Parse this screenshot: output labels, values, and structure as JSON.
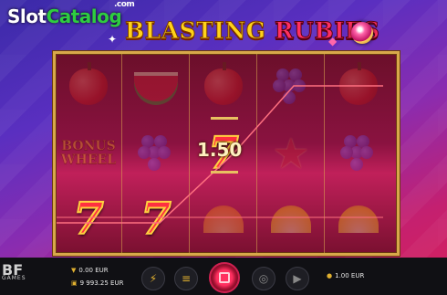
{
  "watermark": {
    "part1": "Slot",
    "part2": "Catalog",
    "suffix": ".com"
  },
  "game": {
    "title_part1": "BLASTING",
    "title_part2": "RUBIES"
  },
  "win": {
    "amount": "1.50"
  },
  "bonus_symbol": {
    "line1": "BONUS",
    "line2": "WHEEL"
  },
  "provider": {
    "logo": "BF",
    "sub": "GAMES"
  },
  "balance": {
    "win_value": "0.00 EUR",
    "balance_value": "9 993.25 EUR",
    "bet_value": "1.00 EUR"
  },
  "reels": [
    [
      "apple",
      "bonus",
      "seven"
    ],
    [
      "melon",
      "grape",
      "seven"
    ],
    [
      "apple",
      "seven",
      "orange"
    ],
    [
      "grape",
      "star",
      "lemon"
    ],
    [
      "apple",
      "grape",
      "lemon"
    ]
  ],
  "controls": {
    "turbo": "lightning-icon",
    "menu": "menu-icon",
    "spin": "spin-icon",
    "bet": "coins-icon",
    "autoplay": "play-icon"
  },
  "colors": {
    "frame": "#d8a84a",
    "dock": "#101014",
    "accent": "#e0b030",
    "payline": "#ff7080"
  }
}
